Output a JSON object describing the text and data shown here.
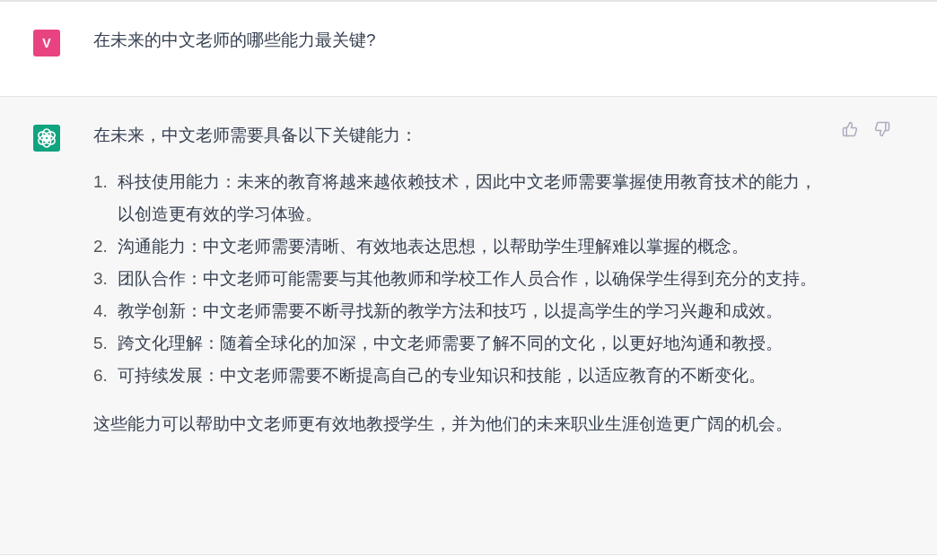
{
  "messages": [
    {
      "kind": "user",
      "avatar": "V",
      "text": "在未来的中文老师的哪些能力最关键?"
    },
    {
      "kind": "assistant",
      "intro": "在未来，中文老师需要具备以下关键能力：",
      "list": [
        {
          "number": "1.",
          "text": "科技使用能力：未来的教育将越来越依赖技术，因此中文老师需要掌握使用教育技术的能力，以创造更有效的学习体验。"
        },
        {
          "number": "2.",
          "text": "沟通能力：中文老师需要清晰、有效地表达思想，以帮助学生理解难以掌握的概念。"
        },
        {
          "number": "3.",
          "text": "团队合作：中文老师可能需要与其他教师和学校工作人员合作，以确保学生得到充分的支持。"
        },
        {
          "number": "4.",
          "text": "教学创新：中文老师需要不断寻找新的教学方法和技巧，以提高学生的学习兴趣和成效。"
        },
        {
          "number": "5.",
          "text": "跨文化理解：随着全球化的加深，中文老师需要了解不同的文化，以更好地沟通和教授。"
        },
        {
          "number": "6.",
          "text": "可持续发展：中文老师需要不断提高自己的专业知识和技能，以适应教育的不断变化。"
        }
      ],
      "conclusion": "这些能力可以帮助中文老师更有效地教授学生，并为他们的未来职业生涯创造更广阔的机会。"
    }
  ]
}
